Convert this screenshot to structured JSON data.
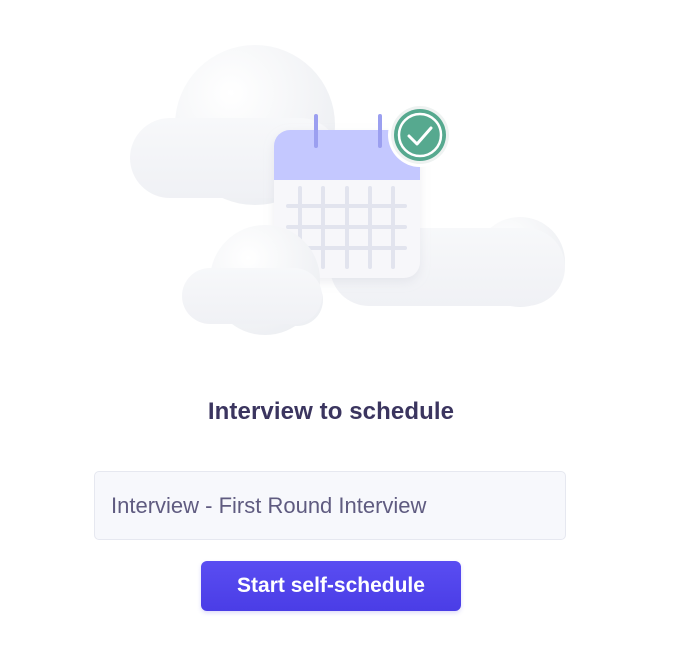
{
  "heading": "Interview to schedule",
  "interview": {
    "name": "Interview - First Round Interview"
  },
  "actions": {
    "start_label": "Start self-schedule"
  },
  "illustration": {
    "icon": "calendar-check-icon",
    "colors": {
      "calendar_header": "#c4c8ff",
      "calendar_grid": "#e2e4ee",
      "calendar_rings": "#9b9ff0",
      "check_badge": "#56a98f",
      "cloud": "#f3f4f7"
    }
  },
  "colors": {
    "heading": "#3b355f",
    "field_text": "#5f5b80",
    "field_bg": "#f7f8fc",
    "button": "#4f43ec"
  }
}
